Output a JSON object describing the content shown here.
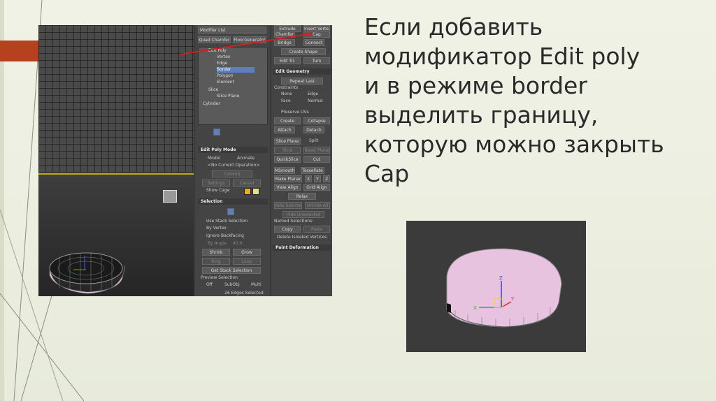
{
  "slide": {
    "title_lines": [
      "Если добавить",
      "модификатор Edit poly",
      "и в режиме border",
      "выделить границу,",
      "которую можно закрыть",
      "Cap"
    ]
  },
  "modifier_panel": {
    "modifier_list": "Modifier List",
    "buttons_top": [
      "Quad Chamfer",
      "FloorGenerator"
    ],
    "stack": [
      {
        "label": "Edit Poly",
        "level": 0
      },
      {
        "label": "Vertex",
        "level": 1
      },
      {
        "label": "Edge",
        "level": 1
      },
      {
        "label": "Border",
        "level": 1,
        "selected": true
      },
      {
        "label": "Polygon",
        "level": 1
      },
      {
        "label": "Element",
        "level": 1
      },
      {
        "label": "Slice",
        "level": 0
      },
      {
        "label": "Slice Plane",
        "level": 1
      },
      {
        "label": "Cylinder",
        "level": 0
      }
    ],
    "edit_poly_mode": {
      "header": "Edit Poly Mode",
      "model": "Model",
      "animate": "Animate",
      "current_op": "<No Current Operation>",
      "commit": "Commit",
      "settings": "Settings",
      "cancel": "Cancel",
      "show_cage": "Show Cage"
    },
    "selection": {
      "header": "Selection",
      "use_stack": "Use Stack Selection",
      "by_vertex": "By Vertex",
      "ignore_backfacing": "Ignore Backfacing",
      "by_angle": "By Angle:",
      "angle_value": "45.0",
      "shrink": "Shrink",
      "grow": "Grow",
      "ring": "Ring",
      "loop": "Loop",
      "get_stack": "Get Stack Selection",
      "preview": "Preview Selection",
      "off": "Off",
      "subobj": "SubObj",
      "multi": "Multi",
      "status": "26 Edges Selected"
    }
  },
  "edit_panel": {
    "top_partial": [
      "Extrude",
      "Insert Vertex"
    ],
    "rows": [
      [
        "Chamfer",
        "Cap"
      ],
      [
        "Bridge",
        "Connect"
      ]
    ],
    "create_shape": "Create Shape",
    "edit_tri": "Edit Tri.",
    "turn": "Turn",
    "edit_geometry": "Edit Geometry",
    "repeat_last": "Repeat Last",
    "constraints": "Constraints",
    "none": "None",
    "edge": "Edge",
    "face": "Face",
    "normal": "Normal",
    "preserve_uvs": "Preserve UVs",
    "create": "Create",
    "collapse": "Collapse",
    "attach": "Attach",
    "detach": "Detach",
    "slice_plane": "Slice Plane",
    "split": "Split",
    "slice": "Slice",
    "reset_plane": "Reset Plane",
    "quickslice": "QuickSlice",
    "cut": "Cut",
    "msmooth": "MSmooth",
    "tessellate": "Tessellate",
    "make_planar": "Make Planar",
    "x": "X",
    "y": "Y",
    "z": "Z",
    "view_align": "View Align",
    "grid_align": "Grid Align",
    "relax": "Relax",
    "hide_selected": "Hide Selected",
    "unhide_all": "Unhide All",
    "hide_unselected": "Hide Unselected",
    "named_selections": "Named Selections:",
    "copy": "Copy",
    "paste": "Paste",
    "delete_isolated": "Delete Isolated Vertices",
    "paint_deformation": "Paint Deformation"
  },
  "colors": {
    "accent": "#b5411e",
    "selection_blue": "#5c7fbf",
    "mesh_pink": "#e7c3df"
  },
  "axis_labels": {
    "z": "Z",
    "x": "X",
    "y": "Y"
  }
}
